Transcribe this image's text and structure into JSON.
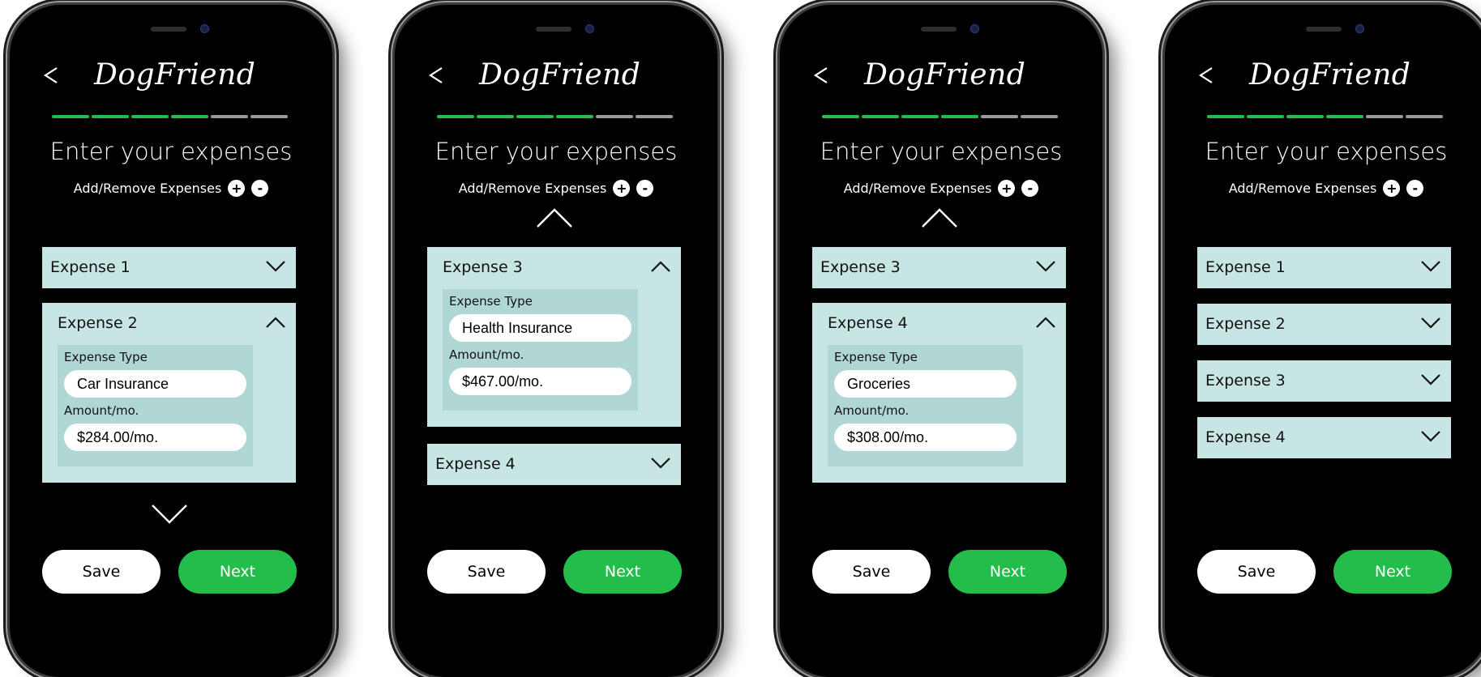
{
  "brand": "DogFriend",
  "colors": {
    "accent": "#23bd4b",
    "panel": "#c7e5e3",
    "inner_panel": "#b1d7d4",
    "progress_off": "#9a9a9a"
  },
  "progress": {
    "completed": 4,
    "total": 6
  },
  "screens": [
    {
      "title": "Enter your expenses",
      "add_remove_label": "Add/Remove Expenses",
      "add_icon": "+",
      "remove_icon": "-",
      "expenses": [
        {
          "label": "Expense 1",
          "state": "collapsed"
        },
        {
          "label": "Expense 2",
          "state": "expanded",
          "type_label": "Expense Type",
          "type_value": "Car Insurance",
          "amount_label": "Amount/mo.",
          "amount_value": "$284.00/mo."
        }
      ],
      "save_label": "Save",
      "next_label": "Next"
    },
    {
      "title": "Enter your expenses",
      "add_remove_label": "Add/Remove Expenses",
      "add_icon": "+",
      "remove_icon": "-",
      "expenses": [
        {
          "label": "Expense 3",
          "state": "expanded",
          "type_label": "Expense Type",
          "type_value": "Health Insurance",
          "amount_label": "Amount/mo.",
          "amount_value": "$467.00/mo."
        },
        {
          "label": "Expense 4",
          "state": "collapsed"
        }
      ],
      "save_label": "Save",
      "next_label": "Next"
    },
    {
      "title": "Enter your expenses",
      "add_remove_label": "Add/Remove Expenses",
      "add_icon": "+",
      "remove_icon": "-",
      "expenses": [
        {
          "label": "Expense 3",
          "state": "collapsed"
        },
        {
          "label": "Expense 4",
          "state": "expanded",
          "type_label": "Expense Type",
          "type_value": "Groceries",
          "amount_label": "Amount/mo.",
          "amount_value": "$308.00/mo."
        }
      ],
      "save_label": "Save",
      "next_label": "Next"
    },
    {
      "title": "Enter your expenses",
      "add_remove_label": "Add/Remove Expenses",
      "add_icon": "+",
      "remove_icon": "-",
      "expenses": [
        {
          "label": "Expense 1",
          "state": "collapsed"
        },
        {
          "label": "Expense 2",
          "state": "collapsed"
        },
        {
          "label": "Expense 3",
          "state": "collapsed"
        },
        {
          "label": "Expense 4",
          "state": "collapsed"
        }
      ],
      "save_label": "Save",
      "next_label": "Next"
    }
  ]
}
